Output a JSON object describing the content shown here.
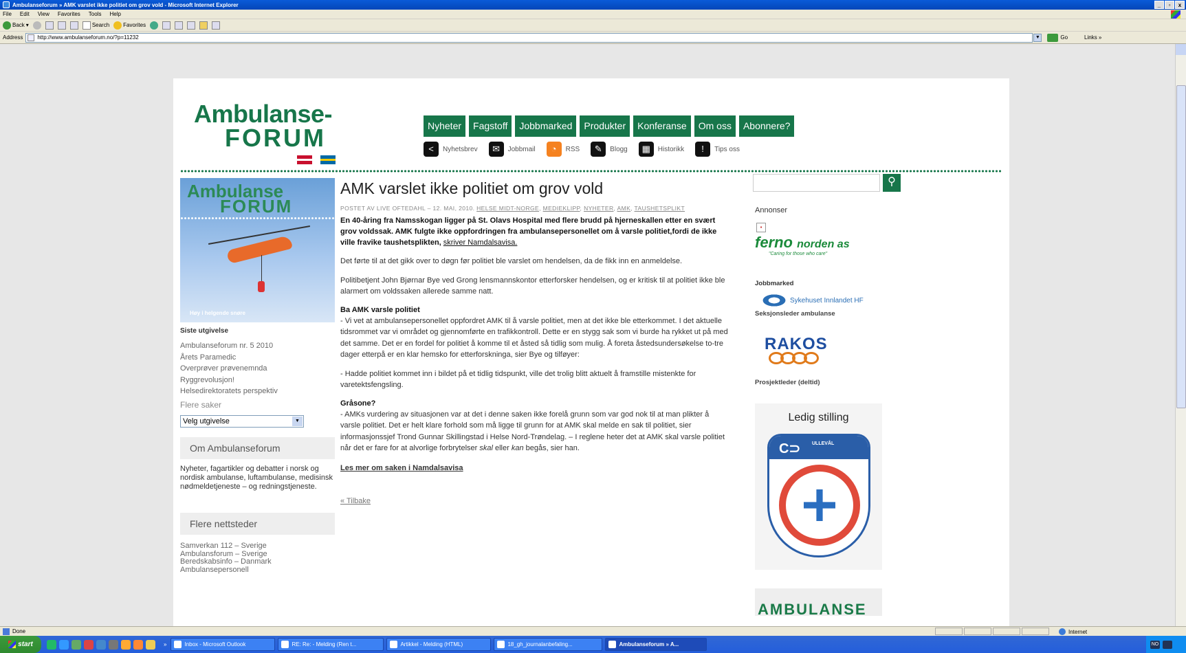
{
  "browser": {
    "window_title": "Ambulanseforum » AMK varslet ikke politiet om grov vold - Microsoft Internet Explorer",
    "window_buttons": [
      "_",
      "▫",
      "x"
    ],
    "menu": [
      "File",
      "Edit",
      "View",
      "Favorites",
      "Tools",
      "Help"
    ],
    "toolbar": {
      "back": "Back",
      "search": "Search",
      "favorites": "Favorites"
    },
    "address_label": "Address",
    "url": "http://www.ambulanseforum.no/?p=11232",
    "go_label": "Go",
    "links_label": "Links »",
    "status_text": "Done",
    "zone_label": "Internet"
  },
  "site": {
    "logo_line1": "Ambulanse-",
    "logo_line2": "FORUM",
    "nav": [
      "Nyheter",
      "Fagstoff",
      "Jobbmarked",
      "Produkter",
      "Konferanse",
      "Om oss",
      "Abonnere?"
    ],
    "subnav": [
      {
        "icon": "share-icon",
        "glyph": "<",
        "label": "Nyhetsbrev"
      },
      {
        "icon": "mail-icon",
        "glyph": "✉",
        "label": "Jobbmail"
      },
      {
        "icon": "rss-icon",
        "glyph": "◔",
        "label": "RSS"
      },
      {
        "icon": "pen-icon",
        "glyph": "✎",
        "label": "Blogg"
      },
      {
        "icon": "archive-icon",
        "glyph": "▦",
        "label": "Historikk"
      },
      {
        "icon": "alert-icon",
        "glyph": "!",
        "label": "Tips oss"
      }
    ],
    "brand_color": "#17764a"
  },
  "left_sidebar": {
    "cover_title1": "Ambulanse",
    "cover_title2": "FORUM",
    "cover_caption": "Høy i helgende snøre",
    "latest_heading": "Siste utgivelse",
    "latest_items": [
      "Ambulanseforum nr. 5 2010",
      "Årets Paramedic",
      "Overprøver prøvenemnda",
      "Ryggrevolusjon!",
      "Helsedirektoratets perspektiv"
    ],
    "more_cases": "Flere saker",
    "select_value": "Velg utgivelse",
    "about_heading": "Om Ambulanseforum",
    "about_text": "Nyheter, fagartikler og debatter i norsk og nordisk ambulanse, luftambulanse, medisinsk nødmeldetjeneste – og redningstjeneste.",
    "sites_heading": "Flere nettsteder",
    "sites": [
      "Samverkan 112 – Sverige",
      "Ambulansforum – Sverige",
      "Beredskabsinfo – Danmark",
      "Ambulansepersonell"
    ]
  },
  "article": {
    "title": "AMK varslet ikke politiet om grov vold",
    "meta_prefix": "POSTET AV LIVE OFTEDAHL – 12. MAI, 2010.",
    "tags": [
      "HELSE MIDT-NORGE",
      "MEDIEKLIPP",
      "NYHETER",
      "AMK",
      "TAUSHETSPLIKT"
    ],
    "lead": "En 40-åring fra Namsskogan ligger på St. Olavs Hospital med flere brudd på hjerneskallen etter en svært grov voldssak. AMK fulgte ikke oppfordringen fra ambulansepersonellet om å varsle politiet,fordi de ikke ville fravike taushetsplikten,",
    "lead_link": "skriver Namdalsavisa.",
    "p1": "Det førte til at det gikk over to døgn før politiet ble varslet om hendelsen, da de fikk inn en anmeldelse.",
    "p2": "Politibetjent John Bjørnar Bye ved Grong lensmannskontor etterforsker hendelsen, og er kritisk til at politiet ikke ble alarmert om voldssaken allerede samme natt.",
    "h1": "Ba AMK varsle politiet",
    "p3": "- Vi vet at ambulansepersonellet oppfordret AMK til å varsle politiet, men at det ikke ble etterkommet. I det aktuelle tidsrommet var vi området og gjennomførte en trafikkontroll. Dette er en stygg sak som vi burde ha rykket ut på med det samme. Det er en fordel for politiet å komme til et åsted så tidlig som mulig. Å foreta åstedsundersøkelse to-tre dager etterpå er en klar hemsko for etterforskninga, sier Bye og tilføyer:",
    "p4": "- Hadde politiet kommet inn i bildet på et tidlig tidspunkt, ville det trolig blitt aktuelt å framstille mistenkte for varetektsfengsling.",
    "h2": "Gråsone?",
    "p5_a": "- AMKs vurdering av situasjonen var at det i denne saken ikke forelå grunn som var god nok til at man plikter å varsle politiet. Det er helt klare forhold som må ligge til grunn for at AMK skal melde en sak til politiet, sier informasjonssjef Trond Gunnar Skillingstad i Helse Nord-Trøndelag. – I reglene heter det at AMK skal varsle politiet når det er fare for at alvorlige forbrytelser",
    "p5_em1": "skal",
    "p5_mid": "eller",
    "p5_em2": "kan",
    "p5_end": "begås, sier han.",
    "read_more": "Les mer om saken i Namdalsavisa",
    "back": "« Tilbake"
  },
  "right_sidebar": {
    "ads_heading": "Annonser",
    "ferno_name": "ferno",
    "ferno_suffix": "norden as",
    "ferno_slogan": "\"Caring for those who care\"",
    "jobs_heading": "Jobbmarked",
    "sykehus_name": "Sykehuset Innlandet HF",
    "job1": "Seksjonsleder ambulanse",
    "rakos_name": "RAKOS",
    "job2": "Prosjektleder (deltid)",
    "vacancy_heading": "Ledig stilling",
    "badge_top": "ULLEVÅL",
    "bottom_banner": "AMBULANSE"
  },
  "taskbar": {
    "start_label": "start",
    "tasks": [
      "Inbox - Microsoft Outlook",
      "RE: Re: - Melding (Ren t...",
      "Artikkel - Melding (HTML)",
      "18_gh_journalanbefaling...",
      "Ambulanseforum » A..."
    ],
    "active_task": 4
  }
}
